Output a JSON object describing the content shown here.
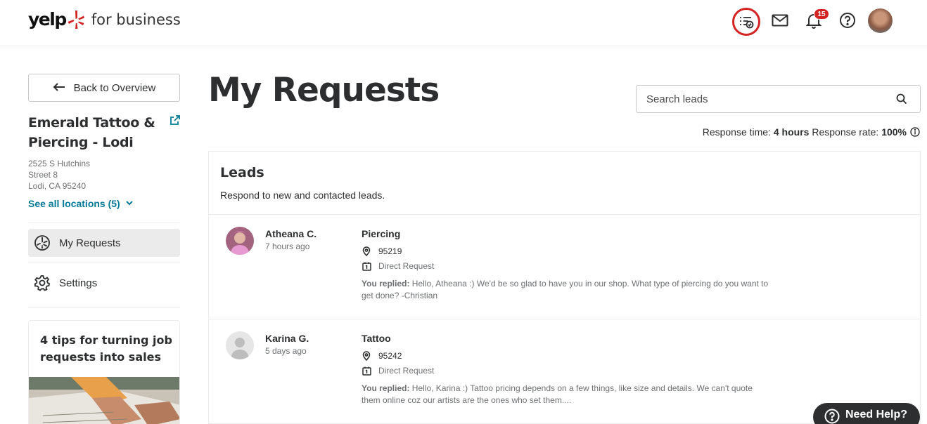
{
  "header": {
    "logo_text": "yelp",
    "logo_subtitle": "for business",
    "notification_count": "15",
    "accent_color": "#d32323"
  },
  "sidebar": {
    "back_label": "Back to Overview",
    "business_name": "Emerald Tattoo & Piercing - Lodi",
    "address_line1": "2525 S Hutchins",
    "address_line2": "Street 8",
    "address_line3": "Lodi, CA 95240",
    "see_all_label": "See all locations (5)",
    "nav": [
      {
        "label": "My Requests",
        "icon": "requests-icon",
        "active": true
      },
      {
        "label": "Settings",
        "icon": "gear-icon",
        "active": false
      }
    ],
    "tips_title": "4 tips for turning job requests into sales"
  },
  "main": {
    "title": "My Requests",
    "search_placeholder": "Search leads",
    "response_time_label": "Response time:",
    "response_time_value": "4 hours",
    "response_rate_label": "Response rate:",
    "response_rate_value": "100%",
    "leads_title": "Leads",
    "leads_subtitle": "Respond to new and contacted leads.",
    "leads": [
      {
        "name": "Atheana C.",
        "time": "7 hours ago",
        "service": "Piercing",
        "zip": "95219",
        "request_type": "Direct Request",
        "reply_label": "You replied:",
        "reply_text": "Hello, Atheana :) We'd be so glad to have you in our shop. What type of piercing do you want to get done? -Christian"
      },
      {
        "name": "Karina G.",
        "time": "5 days ago",
        "service": "Tattoo",
        "zip": "95242",
        "request_type": "Direct Request",
        "reply_label": "You replied:",
        "reply_text": "Hello, Karina :) Tattoo pricing depends on a few things, like size and details. We can't quote them online coz our artists are the ones who set them...."
      }
    ]
  },
  "help_button_label": "Need Help?"
}
